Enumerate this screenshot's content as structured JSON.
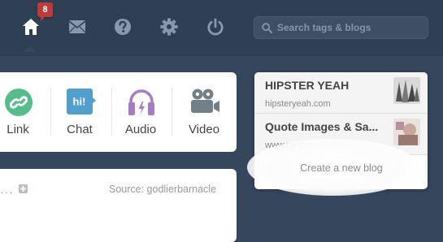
{
  "nav": {
    "home_badge": "8",
    "search_placeholder": "Search tags & blogs"
  },
  "post_types": [
    {
      "label": "Link",
      "icon": "link-icon",
      "color": "#56bc8a"
    },
    {
      "label": "Chat",
      "icon": "chat-icon",
      "color": "#529ecc",
      "glyph": "hi!"
    },
    {
      "label": "Audio",
      "icon": "headphones-icon",
      "color": "#a77dc2"
    },
    {
      "label": "Video",
      "icon": "video-camera-icon",
      "color": "#748089"
    }
  ],
  "post": {
    "source": "Source: godlierbarnacle"
  },
  "blog_menu": {
    "blogs": [
      {
        "title": "HIPSTER YEAH",
        "url": "hipsteryeah.com"
      },
      {
        "title": "Quote Images & Sa...",
        "url": "www.radcupcake.com"
      }
    ],
    "create_label": "Create a new blog"
  }
}
